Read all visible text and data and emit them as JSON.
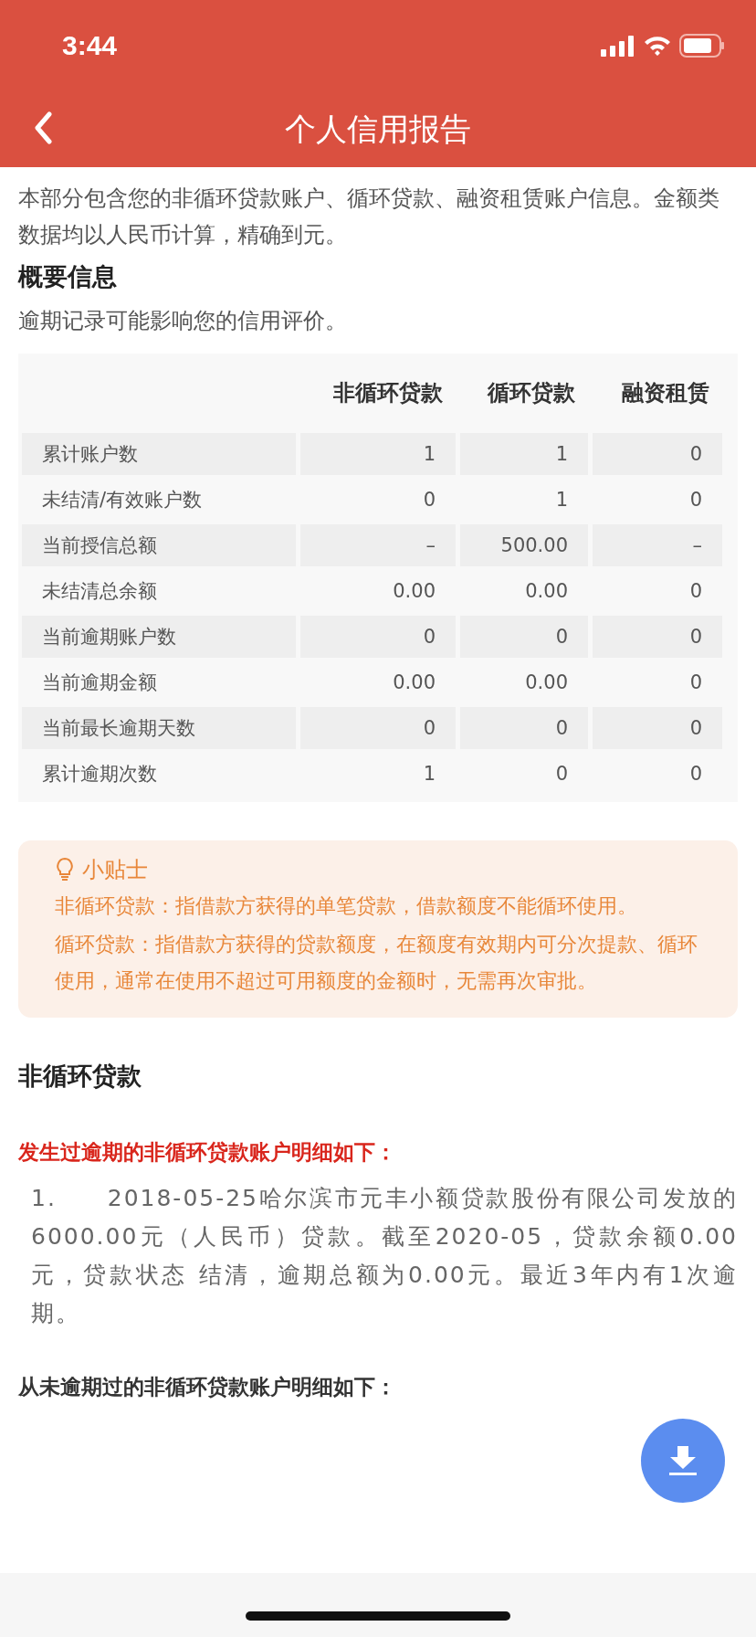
{
  "status_bar": {
    "time": "3:44"
  },
  "nav": {
    "title": "个人信用报告"
  },
  "intro": "本部分包含您的非循环贷款账户、循环贷款、融资租赁账户信息。金额类数据均以人民币计算，精确到元。",
  "summary": {
    "heading": "概要信息",
    "note": "逾期记录可能影响您的信用评价。"
  },
  "table": {
    "columns": [
      "非循环贷款",
      "循环贷款",
      "融资租赁"
    ],
    "rows": [
      {
        "label": "累计账户数",
        "cells": [
          "1",
          "1",
          "0"
        ]
      },
      {
        "label": "未结清/有效账户数",
        "cells": [
          "0",
          "1",
          "0"
        ]
      },
      {
        "label": "当前授信总额",
        "cells": [
          "–",
          "500.00",
          "–"
        ]
      },
      {
        "label": "未结清总余额",
        "cells": [
          "0.00",
          "0.00",
          "0"
        ]
      },
      {
        "label": "当前逾期账户数",
        "cells": [
          "0",
          "0",
          "0"
        ]
      },
      {
        "label": "当前逾期金额",
        "cells": [
          "0.00",
          "0.00",
          "0"
        ]
      },
      {
        "label": "当前最长逾期天数",
        "cells": [
          "0",
          "0",
          "0"
        ]
      },
      {
        "label": "累计逾期次数",
        "cells": [
          "1",
          "0",
          "0"
        ]
      }
    ]
  },
  "tips": {
    "title": "小贴士",
    "paragraphs": [
      "非循环贷款：指借款方获得的单笔贷款，借款额度不能循环使用。",
      "循环贷款：指借款方获得的贷款额度，在额度有效期内可分次提款、循环使用，通常在使用不超过可用额度的金额时，无需再次审批。"
    ]
  },
  "section": {
    "heading": "非循环贷款",
    "overdue_title": "发生过逾期的非循环贷款账户明细如下：",
    "overdue_items": [
      "1.　　2018-05-25哈尔滨市元丰小额贷款股份有限公司发放的6000.00元（人民币）贷款。截至2020-05，贷款余额0.00元，贷款状态 结清，逾期总额为0.00元。最近3年内有1次逾期。"
    ],
    "clean_title": "从未逾期过的非循环贷款账户明细如下："
  }
}
